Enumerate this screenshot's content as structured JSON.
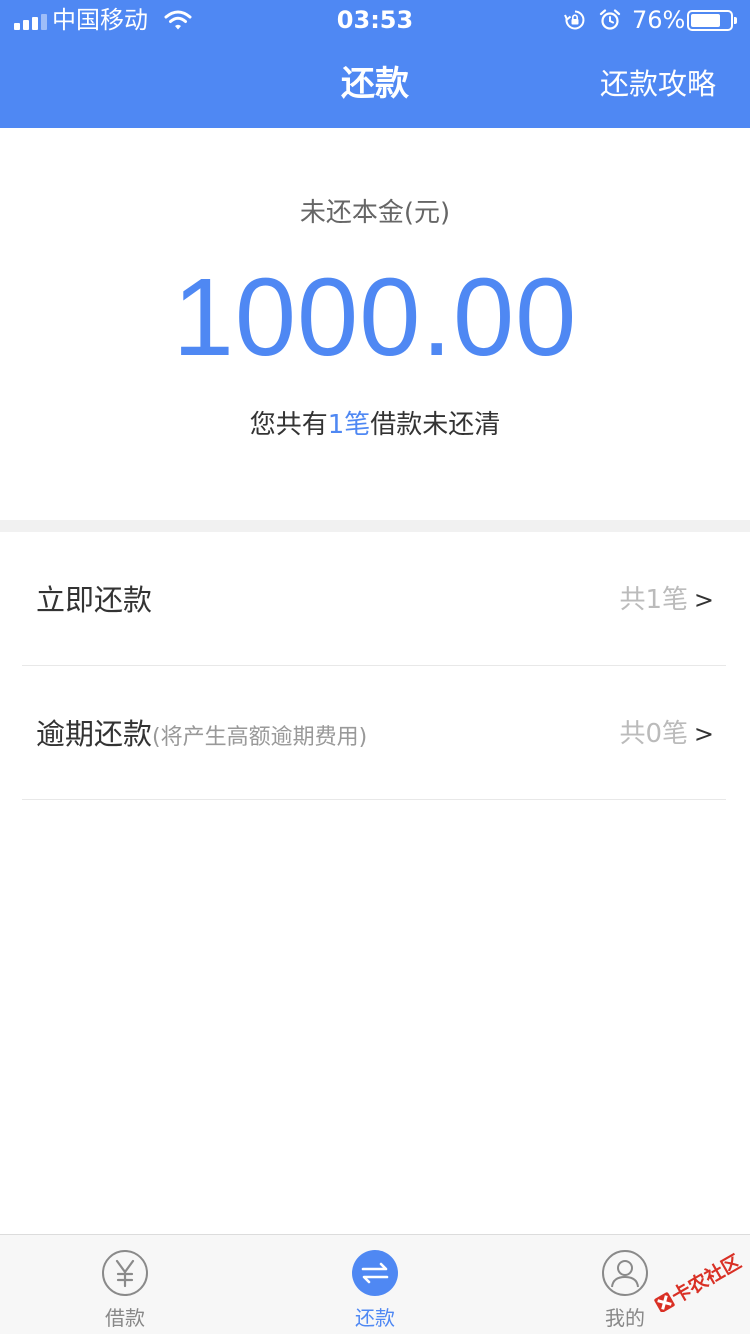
{
  "status_bar": {
    "carrier": "中国移动",
    "time": "03:53",
    "battery_percent": "76%",
    "battery_level": 0.76
  },
  "nav": {
    "title": "还款",
    "right_link": "还款攻略"
  },
  "summary": {
    "label": "未还本金(元)",
    "amount": "1000.00",
    "note_prefix": "您共有",
    "note_count": "1笔",
    "note_suffix": "借款未还清"
  },
  "rows": [
    {
      "title": "立即还款",
      "subtitle": "",
      "count": "共1笔",
      "chevron": ">"
    },
    {
      "title": "逾期还款",
      "subtitle": "(将产生高额逾期费用)",
      "count": "共0笔",
      "chevron": ">"
    }
  ],
  "tabbar": {
    "items": [
      {
        "label": "借款",
        "icon": "yen-circle-icon"
      },
      {
        "label": "还款",
        "icon": "transfer-arrows-icon",
        "active": true
      },
      {
        "label": "我的",
        "icon": "user-circle-icon"
      }
    ]
  },
  "watermark": {
    "text": "卡农社区"
  },
  "colors": {
    "accent": "#4f88f3",
    "muted": "#999999",
    "background": "#ffffff"
  }
}
